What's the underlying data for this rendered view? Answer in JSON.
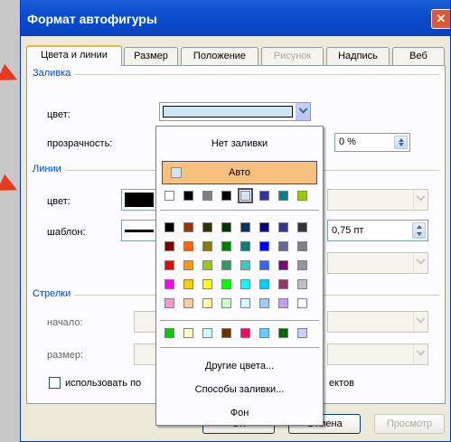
{
  "window": {
    "title": "Формат автофигуры",
    "close_glyph": "✕"
  },
  "tabs": [
    {
      "label": "Цвета и линии",
      "active": true
    },
    {
      "label": "Размер"
    },
    {
      "label": "Положение"
    },
    {
      "label": "Рисунок",
      "disabled": true
    },
    {
      "label": "Надпись"
    },
    {
      "label": "Веб"
    }
  ],
  "fill": {
    "group_label": "Заливка",
    "color_label": "цвет:",
    "color_value": "#cde6f5",
    "transparency_label": "прозрачность:",
    "transparency_value": "0 %"
  },
  "lines": {
    "group_label": "Линии",
    "color_label": "цвет:",
    "pattern_label": "шаблон:",
    "weight_value": "0,75 пт"
  },
  "arrows": {
    "group_label": "Стрелки",
    "start_label": "начало:",
    "size_label": "размер:"
  },
  "checkbox": {
    "label_part1": "использовать по",
    "label_part2": "ектов"
  },
  "buttons": {
    "ok_label": "ОК",
    "cancel_label": "Отмена",
    "preview_label": "Просмотр"
  },
  "color_popup": {
    "no_fill": "Нет заливки",
    "auto": "Авто",
    "more_colors": "Другие цвета...",
    "fill_effects": "Способы заливки...",
    "background": "Фон",
    "recent_row": [
      "#ffffff",
      "#000000",
      "#808080",
      "#000000",
      "#cde6f5",
      "#333399",
      "#008080",
      "#99cc00"
    ],
    "recent_selected_index": 4,
    "palette": [
      [
        "#000000",
        "#993300",
        "#333300",
        "#003300",
        "#003366",
        "#000080",
        "#333399",
        "#333333"
      ],
      [
        "#800000",
        "#ff6600",
        "#808000",
        "#008000",
        "#008080",
        "#0000ff",
        "#666699",
        "#808080"
      ],
      [
        "#ff0000",
        "#ff9900",
        "#99cc00",
        "#339966",
        "#33cccc",
        "#3366ff",
        "#800080",
        "#969696"
      ],
      [
        "#ff00ff",
        "#ffcc00",
        "#ffff00",
        "#00ff00",
        "#00ffff",
        "#00ccff",
        "#993366",
        "#c0c0c0"
      ],
      [
        "#ff99cc",
        "#ffcc99",
        "#ffff99",
        "#ccffcc",
        "#ccffff",
        "#99ccff",
        "#cc99ff",
        "#ffffff"
      ]
    ],
    "custom_row": [
      "#00cc00",
      "#ffffcc",
      "#ccffff",
      "#663300",
      "#ff0066",
      "#66ccff",
      "#006600",
      "#ccccff"
    ]
  }
}
